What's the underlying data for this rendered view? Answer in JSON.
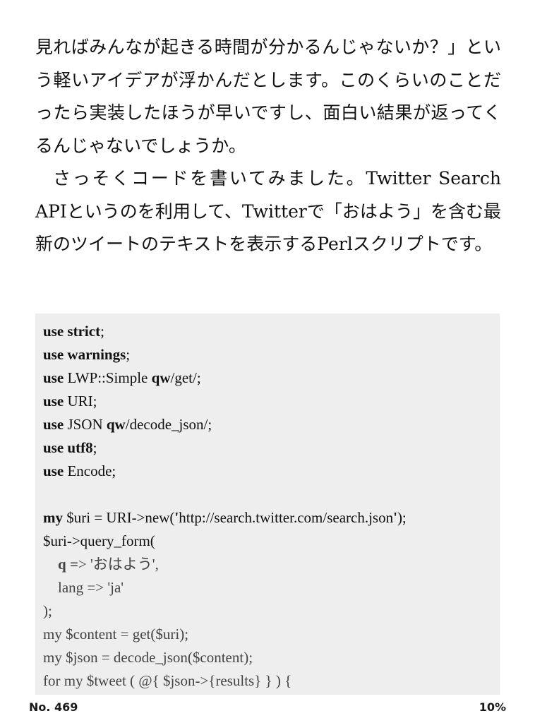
{
  "paragraphs": [
    "見ればみんなが起きる時間が分かるんじゃないか？」という軽いアイデアが浮かんだとします。このくらいのことだったら実装したほうが早いですし、面白い結果が返ってくるんじゃないでしょうか。",
    "さっそくコードを書いてみました。Twitter Search APIというのを利用して、Twitterで「おはよう」を含む最新のツイートのテキストを表示するPerlスクリプトです。"
  ],
  "code": {
    "lines": [
      [
        {
          "t": "use strict",
          "b": true
        },
        {
          "t": ";"
        }
      ],
      [
        {
          "t": "use warnings",
          "b": true
        },
        {
          "t": ";"
        }
      ],
      [
        {
          "t": "use",
          "b": true
        },
        {
          "t": " LWP::Simple "
        },
        {
          "t": "qw",
          "b": true
        },
        {
          "t": "/get/;"
        }
      ],
      [
        {
          "t": "use",
          "b": true
        },
        {
          "t": " URI;"
        }
      ],
      [
        {
          "t": "use",
          "b": true
        },
        {
          "t": " JSON "
        },
        {
          "t": "qw",
          "b": true
        },
        {
          "t": "/decode_json/;"
        }
      ],
      [
        {
          "t": "use utf8",
          "b": true
        },
        {
          "t": ";"
        }
      ],
      [
        {
          "t": "use",
          "b": true
        },
        {
          "t": " Encode;"
        }
      ],
      [],
      [
        {
          "t": "my",
          "b": true
        },
        {
          "t": " $uri = URI->new("
        },
        {
          "t": "'",
          "b": true
        },
        {
          "t": "http://search.twitter.com/search.json"
        },
        {
          "t": "'",
          "b": true
        },
        {
          "t": ");"
        }
      ],
      [
        {
          "t": "$uri->query_form("
        }
      ],
      [
        {
          "t": "    "
        },
        {
          "t": "q",
          "b": true
        },
        {
          "t": " =",
          "b": true
        },
        {
          "t": "> 'おはよう',"
        }
      ],
      [
        {
          "t": "    lang => 'ja'"
        }
      ],
      [
        {
          "t": ");"
        }
      ],
      [
        {
          "t": "my $content = get($uri);"
        }
      ],
      [
        {
          "t": "my $json = decode_json($content);"
        }
      ],
      [
        {
          "t": "for my $tweet ( @{ $json->{results} } ) {"
        }
      ]
    ],
    "dim_from_line": 10
  },
  "footer": {
    "location": "No. 469",
    "progress": "10%"
  }
}
